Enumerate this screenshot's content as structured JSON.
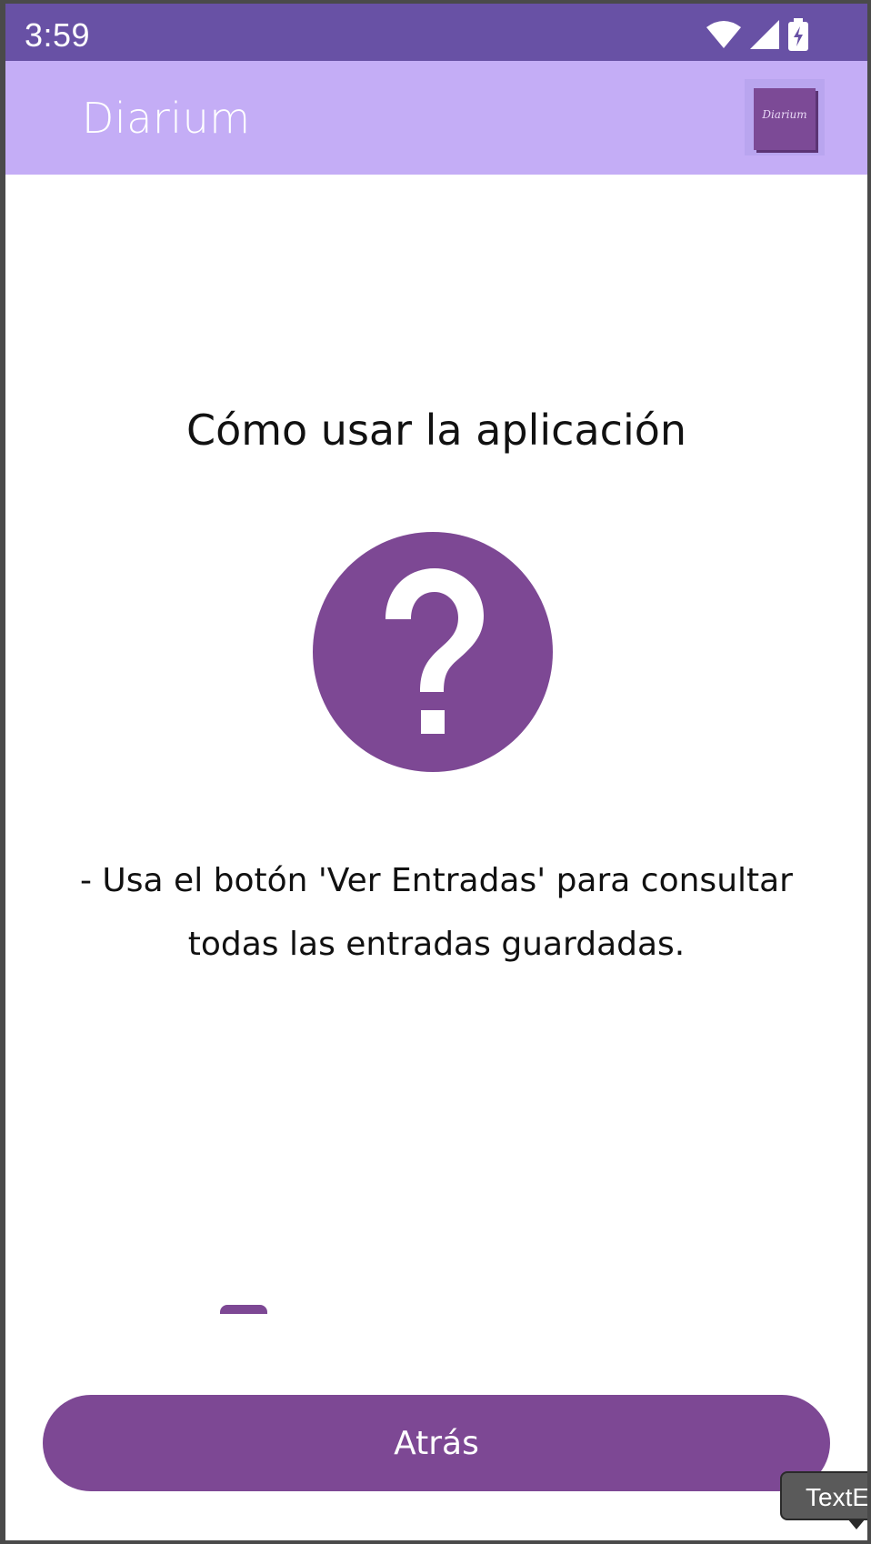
{
  "status_bar": {
    "time": "3:59",
    "icons": [
      "wifi-icon",
      "cellular-signal-icon",
      "battery-charging-icon"
    ],
    "background": "#6851a5"
  },
  "app_bar": {
    "title": "Diarium",
    "logo_text": "Diarium",
    "background": "#c4adf6"
  },
  "main": {
    "title": "Cómo usar la aplicación",
    "icon": "help-circle-icon",
    "text": "- Usa el botón 'Ver Entradas' para consultar todas las entradas guardadas."
  },
  "footer": {
    "back_label": "Atrás"
  },
  "tooltip": {
    "text": "TextEd"
  },
  "colors": {
    "accent": "#7d4894",
    "app_bar": "#c4adf6",
    "status_bar": "#6851a5"
  }
}
